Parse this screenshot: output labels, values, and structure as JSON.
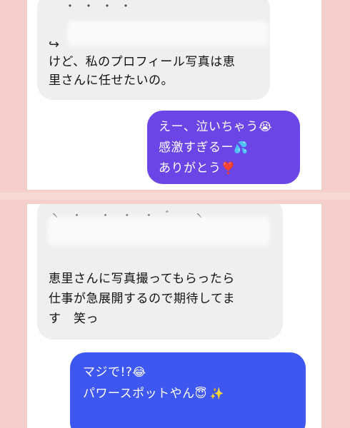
{
  "chat1": {
    "incoming": {
      "arrow": "↪",
      "line1": "けど、私のプロフィール写真は恵",
      "line2": "里さんに任せたいの。"
    },
    "outgoing": {
      "line1": "えー、泣いちゃう",
      "emoji1": "😭",
      "line2": "感激すぎるー",
      "emoji2": "💦",
      "line3": "ありがとう",
      "emoji3": "❣️"
    }
  },
  "chat2": {
    "incoming": {
      "line1": "恵里さんに写真撮ってもらったら",
      "line2": "仕事が急展開するので期待してま",
      "line3": "す　笑っ"
    },
    "outgoing": {
      "line1": "マジで!?",
      "emoji1": "😂",
      "line2": "パワースポットやん",
      "emoji2": "😇",
      "emoji3": "✨"
    }
  },
  "colors": {
    "frame": "#f4cfcb",
    "incoming_bubble": "#efefef",
    "outgoing_purple": "#6b45e6",
    "outgoing_blue": "#3e57f0"
  }
}
